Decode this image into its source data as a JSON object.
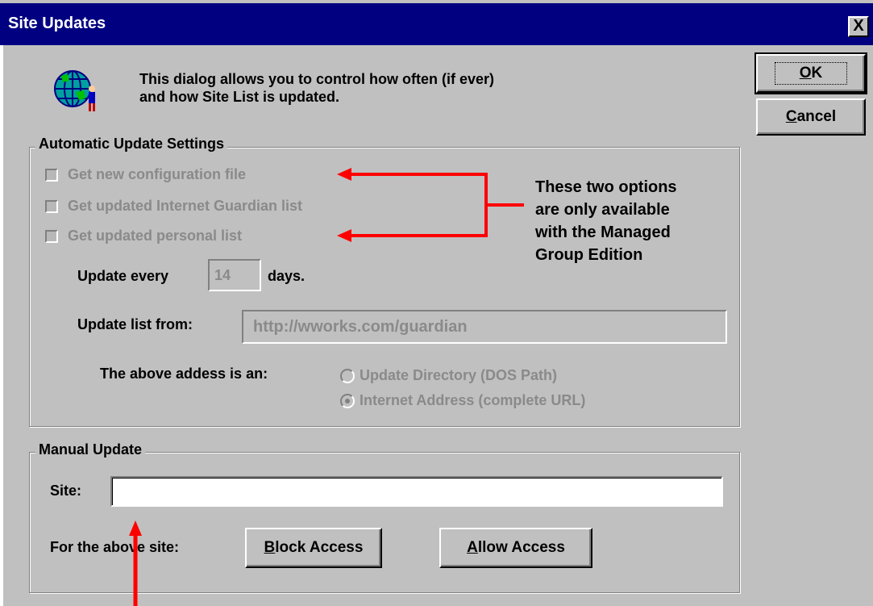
{
  "window": {
    "title": "Site Updates",
    "close_label": "X"
  },
  "header": {
    "icon": "globe-user-icon",
    "intro_line1": "This dialog allows you to control how often (if ever)",
    "intro_line2": "and how Site List is updated."
  },
  "buttons": {
    "ok_prefix": "O",
    "ok_rest": "K",
    "cancel_prefix": "C",
    "cancel_rest": "ancel",
    "block_prefix": "B",
    "block_rest": "lock Access",
    "allow_prefix": "A",
    "allow_rest": "llow Access"
  },
  "auto_settings": {
    "title": "Automatic Update Settings",
    "checkboxes": [
      {
        "label": "Get new configuration file",
        "checked": false,
        "enabled": false
      },
      {
        "label": "Get updated Internet Guardian list",
        "checked": false,
        "enabled": false
      },
      {
        "label": "Get updated personal list",
        "checked": false,
        "enabled": false
      }
    ],
    "update_every_label": "Update every",
    "days_value": "14",
    "days_label": "days.",
    "update_from_label": "Update list from:",
    "update_from_value": "http://wworks.com/guardian",
    "address_type_label": "The above addess is an:",
    "address_options": [
      {
        "label": "Update Directory (DOS Path)",
        "selected": false
      },
      {
        "label": "Internet Address (complete URL)",
        "selected": true
      }
    ]
  },
  "annotation": {
    "line1": "These two options",
    "line2": "are only available",
    "line3": "with the Managed",
    "line4": "Group Edition",
    "color": "#ff0000"
  },
  "manual": {
    "title": "Manual Update",
    "site_label": "Site:",
    "site_value": "",
    "for_site_label": "For the above site:"
  }
}
